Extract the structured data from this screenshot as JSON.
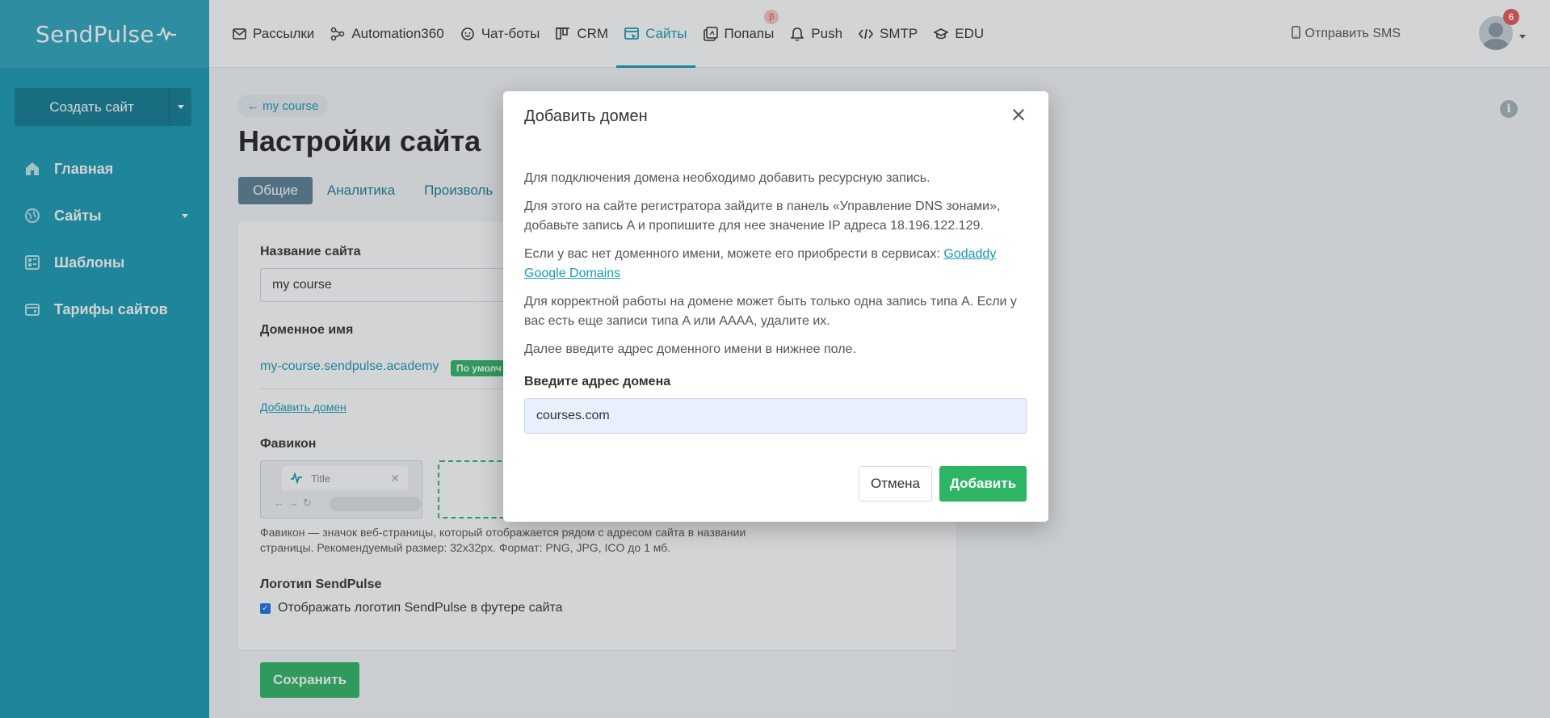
{
  "brand": {
    "logo_text": "SendPulse"
  },
  "sidebar": {
    "create_button": "Создать сайт",
    "items": [
      {
        "label": "Главная",
        "icon": "home-icon"
      },
      {
        "label": "Сайты",
        "icon": "sites-icon"
      },
      {
        "label": "Шаблоны",
        "icon": "templates-icon"
      },
      {
        "label": "Тарифы сайтов",
        "icon": "pricing-icon"
      }
    ]
  },
  "topnav": {
    "items": [
      {
        "label": "Рассылки",
        "icon": "mail-icon"
      },
      {
        "label": "Automation360",
        "icon": "automation-icon"
      },
      {
        "label": "Чат-боты",
        "icon": "chatbot-icon"
      },
      {
        "label": "CRM",
        "icon": "crm-icon"
      },
      {
        "label": "Сайты",
        "icon": "sites-icon",
        "active": true
      },
      {
        "label": "Попапы",
        "icon": "popups-icon",
        "badge": "β"
      },
      {
        "label": "Push",
        "icon": "bell-icon"
      },
      {
        "label": "SMTP",
        "icon": "code-icon"
      },
      {
        "label": "EDU",
        "icon": "graduation-icon"
      }
    ],
    "send_sms": "Отправить SMS",
    "notifications_count": "6"
  },
  "page": {
    "back_link": "← my course",
    "title": "Настройки сайта",
    "tabs": [
      "Общие",
      "Аналитика",
      "Произволь"
    ],
    "site_name_label": "Название сайта",
    "site_name_value": "my course",
    "domain_label": "Доменное имя",
    "domain_value": "my-course.sendpulse.academy",
    "default_badge": "По умолч",
    "add_domain_link": "Добавить домен",
    "favicon_label": "Фавикон",
    "favicon_preview_title": "Title",
    "favicon_help": "Фавикон — значок веб-страницы, который отображается рядом с адресом сайта в названии страницы. Рекомендуемый размер: 32x32px. Формат: PNG, JPG, ICO до 1 мб.",
    "logo_label": "Логотип SendPulse",
    "logo_checkbox": "Отображать логотип SendPulse в футере сайта",
    "save_button": "Сохранить"
  },
  "modal": {
    "title": "Добавить домен",
    "p1": "Для подключения домена необходимо добавить ресурсную запись.",
    "p2": "Для этого на сайте регистратора зайдите в панель «Управление DNS зонами», добавьте запись A и пропишите для нее значение IP адреса 18.196.122.129.",
    "p3_text": "Если у вас нет доменного имени, можете его приобрести в сервисах: ",
    "link_godaddy": "Godaddy",
    "link_google": "Google Domains",
    "p4": "Для корректной работы на домене может быть только одна запись типа A. Если у вас есть еще записи типа A или AAAA, удалите их.",
    "p5": "Далее введите адрес доменного имени в нижнее поле.",
    "input_label": "Введите адрес домена",
    "input_value": "courses.com",
    "cancel": "Отмена",
    "add": "Добавить"
  },
  "colors": {
    "accent": "#1a9ab4",
    "success": "#2eb564",
    "sidebar": "#1a9ab4"
  }
}
